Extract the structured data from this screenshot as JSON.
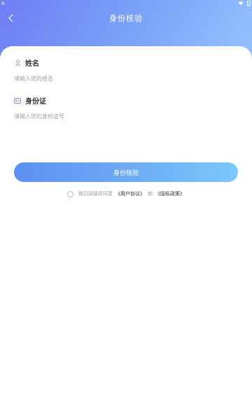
{
  "status_bar": {
    "left_glyph": "A"
  },
  "header": {
    "title": "身份核验"
  },
  "form": {
    "name": {
      "label": "姓名",
      "placeholder": "请输入您的姓名"
    },
    "id_card": {
      "label": "身份证",
      "placeholder": "请输入您的身份证号"
    }
  },
  "submit": {
    "label": "身份核验"
  },
  "agreement": {
    "prefix": "我已阅读并同意",
    "user_agreement": "《用户协议》",
    "and": "和",
    "privacy_policy": "《隐私政策》"
  },
  "colors": {
    "hero_gradient": [
      "#6f7df5",
      "#9cc7ff"
    ],
    "button_gradient": [
      "#5e8ff2",
      "#7bc8fb"
    ],
    "title_text": "#ffffff",
    "placeholder_text": "#a0a0a0"
  },
  "icons": {
    "back": "chevron-left-icon",
    "name": "person-icon",
    "id_card": "id-card-icon",
    "wifi": "wifi-icon",
    "battery": "battery-icon"
  }
}
